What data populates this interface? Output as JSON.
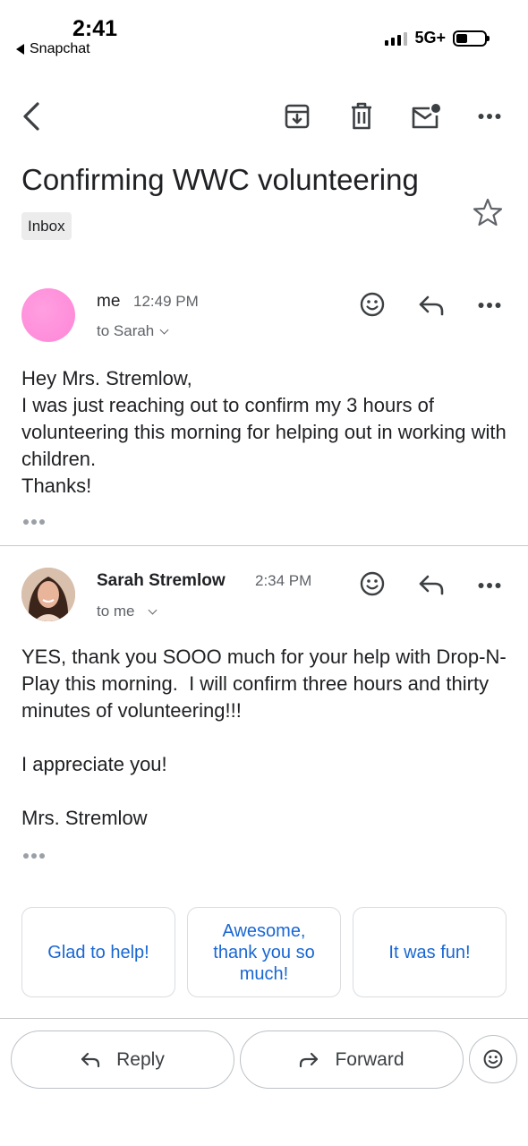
{
  "status_bar": {
    "time": "2:41",
    "back_app": "Snapchat",
    "network": "5G+"
  },
  "toolbar": {
    "back_icon": "back-arrow-icon",
    "archive_icon": "archive-icon",
    "delete_icon": "trash-icon",
    "mark_unread_icon": "mark-unread-icon",
    "more_icon": "more-icon"
  },
  "thread": {
    "subject": "Confirming WWC volunteering",
    "label": "Inbox"
  },
  "messages": [
    {
      "sender": "me",
      "time": "12:49 PM",
      "to": "to Sarah",
      "avatar_color": "#ff8fdb",
      "body": "Hey Mrs. Stremlow,\nI was just reaching out to confirm my 3 hours of volunteering this morning for helping out in working with children.\nThanks!"
    },
    {
      "sender": "Sarah Stremlow",
      "time": "2:34 PM",
      "to": "to me",
      "body": "YES, thank you SOOO much for your help with Drop-N-Play this morning.  I will confirm three hours and thirty minutes of volunteering!!!\n\nI appreciate you!\n\nMrs. Stremlow"
    }
  ],
  "smart_replies": [
    "Glad to help!",
    "Awesome, thank you so much!",
    "It was fun!"
  ],
  "actions": {
    "reply": "Reply",
    "forward": "Forward"
  },
  "colors": {
    "accent": "#1967d2",
    "text": "#202124",
    "muted": "#5f6368"
  }
}
